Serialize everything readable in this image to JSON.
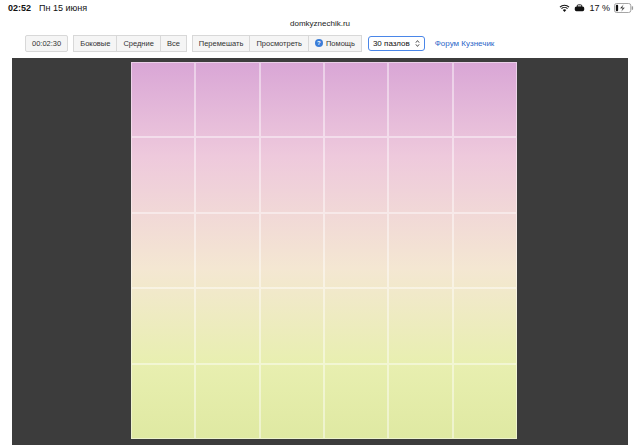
{
  "status_bar": {
    "time": "02:52",
    "date": "Пн 15 июня",
    "battery": "17 %",
    "battery_level": 0.17,
    "charging": true
  },
  "address_bar": {
    "url": "domkyznechik.ru"
  },
  "toolbar": {
    "timer": "00:02:30",
    "filters": [
      {
        "label": "Боковые",
        "selected": false
      },
      {
        "label": "Средние",
        "selected": false
      },
      {
        "label": "Все",
        "selected": false
      }
    ],
    "actions": [
      "Перемешать",
      "Просмотреть"
    ],
    "help": {
      "icon": "?",
      "label": "Помощь"
    },
    "pieces_select": {
      "value": "30 пазлов"
    },
    "forum_link": "Форум Кузнечик"
  },
  "puzzle": {
    "columns": 6,
    "rows": 5
  }
}
